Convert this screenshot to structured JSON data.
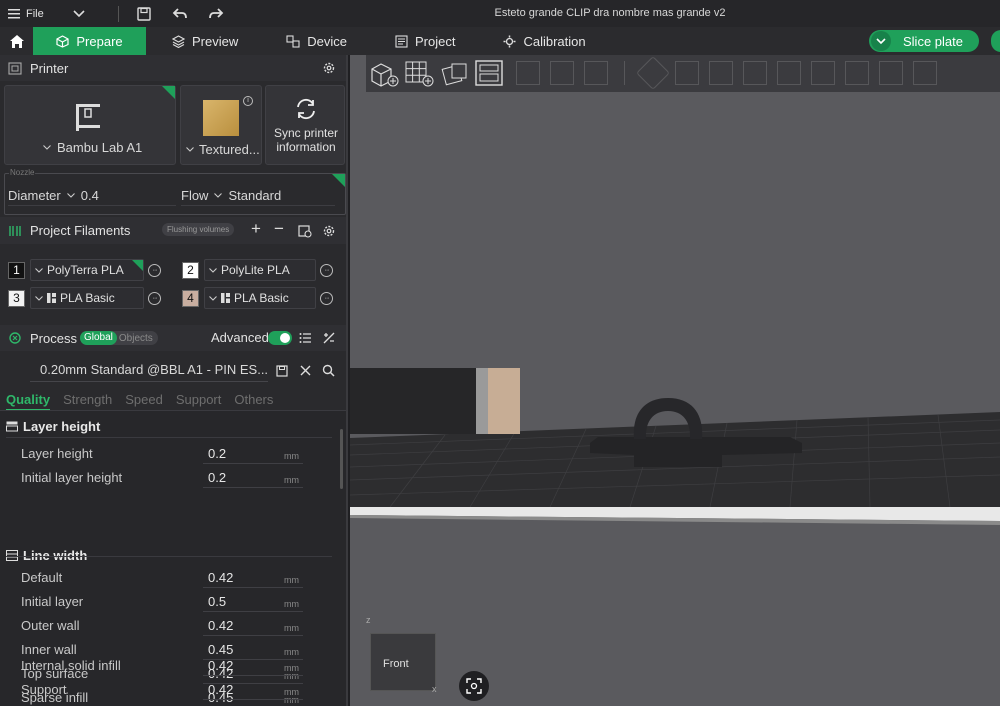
{
  "titlebar": {
    "file_label": "File",
    "title": "Esteto grande CLIP dra nombre mas grande v2"
  },
  "nav": {
    "tabs": [
      {
        "label": "Prepare",
        "icon": "cube-icon",
        "active": true
      },
      {
        "label": "Preview",
        "icon": "layers-icon"
      },
      {
        "label": "Device",
        "icon": "device-icon"
      },
      {
        "label": "Project",
        "icon": "project-icon"
      },
      {
        "label": "Calibration",
        "icon": "calibration-icon"
      }
    ],
    "slice_label": "Slice plate"
  },
  "printer": {
    "section_title": "Printer",
    "printer_name": "Bambu Lab A1",
    "plate_name": "Textured...",
    "sync_label_1": "Sync printer",
    "sync_label_2": "information",
    "nozzle_legend": "Nozzle",
    "diameter_label": "Diameter",
    "diameter_value": "0.4",
    "flow_label": "Flow",
    "flow_value": "Standard"
  },
  "filaments": {
    "section_title": "Project Filaments",
    "flushing_label": "Flushing volumes",
    "items": [
      {
        "num": "1",
        "name": "PolyTerra PLA",
        "color": "#111111"
      },
      {
        "num": "2",
        "name": "PolyLite PLA",
        "color": "#ffffff"
      },
      {
        "num": "3",
        "name": "PLA Basic",
        "color": "#f2f2f2"
      },
      {
        "num": "4",
        "name": "PLA Basic",
        "color": "#c8aea0"
      }
    ]
  },
  "process": {
    "section_title": "Process",
    "global_label": "Global",
    "objects_label": "Objects",
    "advanced_label": "Advanced",
    "preset": "0.20mm Standard @BBL A1 - PIN ES...",
    "subtabs": [
      "Quality",
      "Strength",
      "Speed",
      "Support",
      "Others"
    ]
  },
  "settings": {
    "layer_height_group": "Layer height",
    "line_width_group": "Line width",
    "unit": "mm",
    "layer_params": [
      {
        "label": "Layer height",
        "value": "0.2"
      },
      {
        "label": "Initial layer height",
        "value": "0.2"
      }
    ],
    "line_params": [
      {
        "label": "Default",
        "value": "0.42"
      },
      {
        "label": "Initial layer",
        "value": "0.5"
      },
      {
        "label": "Outer wall",
        "value": "0.42"
      },
      {
        "label": "Inner wall",
        "value": "0.45"
      },
      {
        "label": "Top surface",
        "value": "0.42"
      },
      {
        "label": "Sparse infill",
        "value": "0.45"
      },
      {
        "label": "Internal solid infill",
        "value": "0.42"
      },
      {
        "label": "Support",
        "value": "0.42"
      }
    ]
  },
  "viewport": {
    "view_label": "Front",
    "axis_z": "z",
    "axis_x": "x",
    "accent": "#1fa05a"
  }
}
